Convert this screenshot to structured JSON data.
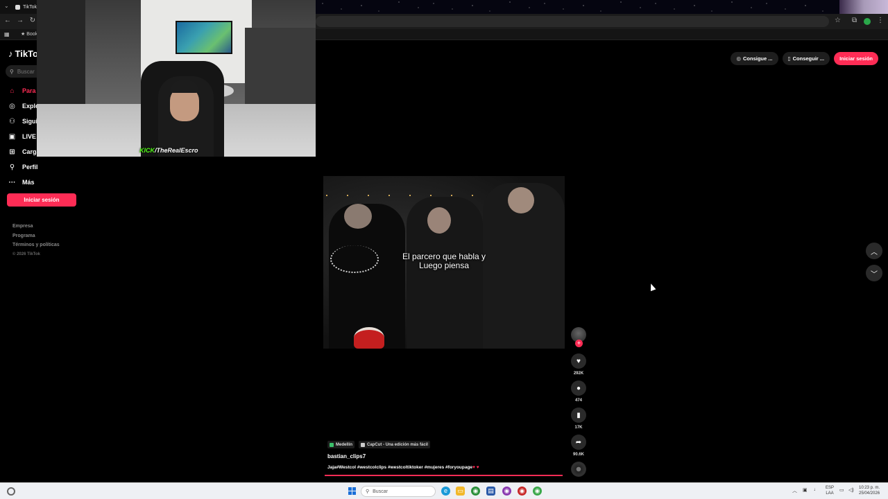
{
  "browser": {
    "tab_title": "TikTok",
    "bookmark_label": "Book",
    "colors": {
      "accent": "#fe2c55",
      "extension_green": "#2aa84a"
    }
  },
  "sidebar": {
    "logo_text": "TikTo",
    "search_placeholder": "Buscar",
    "items": [
      {
        "label": "Para t",
        "icon": "home-icon"
      },
      {
        "label": "Explo",
        "icon": "compass-icon"
      },
      {
        "label": "Siguie",
        "icon": "user-follow-icon"
      },
      {
        "label": "LIVE",
        "icon": "live-icon"
      },
      {
        "label": "Carga",
        "icon": "upload-icon"
      },
      {
        "label": "Perfil",
        "icon": "person-icon"
      },
      {
        "label": "Más",
        "icon": "more-icon"
      }
    ],
    "login_label": "Iniciar sesión",
    "footer": {
      "company": "Empresa",
      "program": "Programa",
      "terms": "Términos y políticas",
      "copyright": "© 2026 TikTok"
    }
  },
  "webcam": {
    "kick_label": "KICK",
    "channel": "/TheRealEscro"
  },
  "top_actions": {
    "coins_label": "Consigue ...",
    "app_label": "Conseguir ...",
    "login_label": "Iniciar sesión"
  },
  "video": {
    "caption_line1": "El parcero que habla y",
    "caption_line2": "Luego piensa",
    "location_tag": "Medellín",
    "capcut_tag": "CapCut - Una edición más fácil",
    "username": "bastian_clips7",
    "description": "Jaja#Westcol #westcolclips #westcoltiktoker #mujeres #foryoupage",
    "progress": 0.99
  },
  "actions": {
    "likes": "292K",
    "comments": "474",
    "saves": "17K",
    "shares": "90.6K"
  },
  "taskbar": {
    "search_placeholder": "Buscar",
    "lang_line1": "ESP",
    "lang_line2": "LAA",
    "time": "10:23 p. m.",
    "date": "25/04/2026"
  }
}
